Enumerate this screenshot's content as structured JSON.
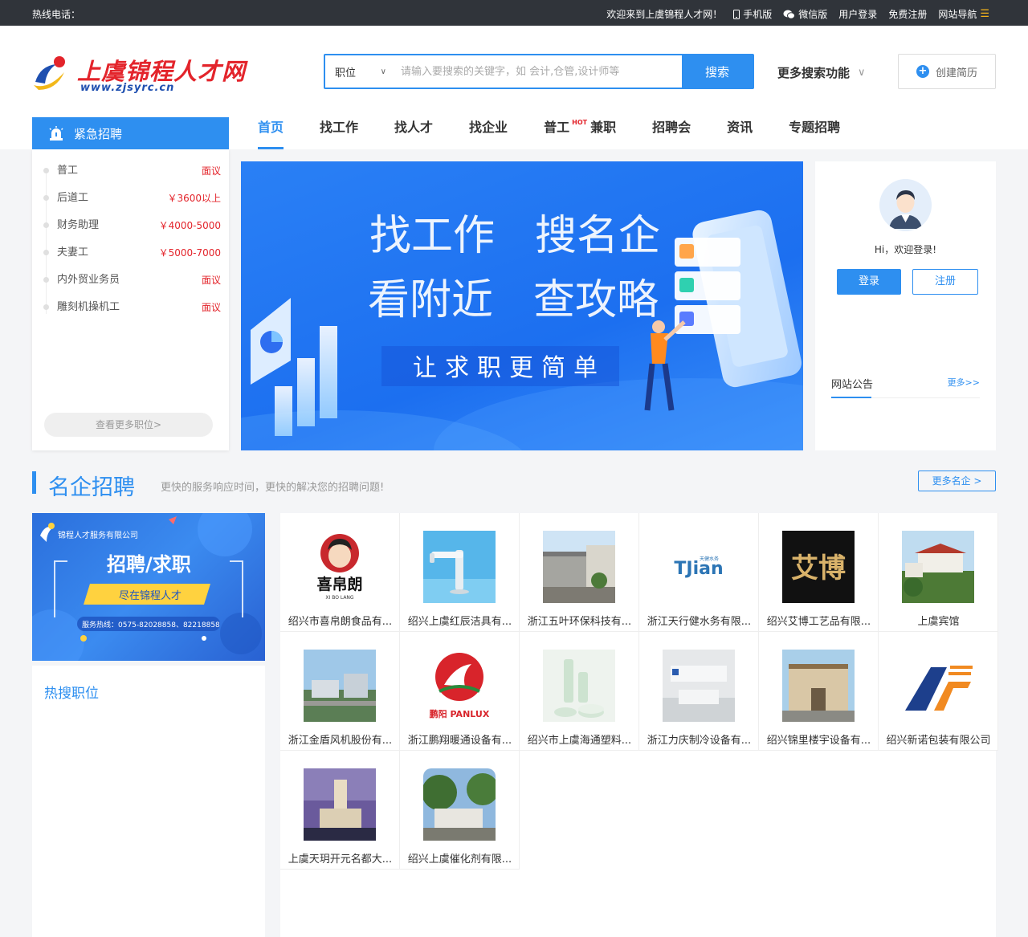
{
  "topbar": {
    "hotline": "热线电话：",
    "welcome": "欢迎来到上虞锦程人才网！",
    "mobile": "手机版",
    "wechat": "微信版",
    "login": "用户登录",
    "register": "免费注册",
    "sitenav": "网站导航"
  },
  "logo": {
    "name": "上虞锦程人才网",
    "domain": "www.zjsyrc.cn"
  },
  "search": {
    "category": "职位",
    "placeholder": "请输入要搜索的关键字，如 会计,仓管,设计师等",
    "button": "搜索"
  },
  "more_search": "更多搜索功能",
  "create_resume": "创建简历",
  "nav": [
    {
      "label": "首页",
      "active": true
    },
    {
      "label": "找工作"
    },
    {
      "label": "找人才"
    },
    {
      "label": "找企业"
    },
    {
      "label": "普工",
      "badge": "HOT"
    },
    {
      "label": "兼职"
    },
    {
      "label": "招聘会"
    },
    {
      "label": "资讯"
    },
    {
      "label": "专题招聘"
    }
  ],
  "urgent": {
    "title": "紧急招聘",
    "jobs": [
      {
        "title": "普工",
        "salary": "面议"
      },
      {
        "title": "后道工",
        "salary": "￥3600以上"
      },
      {
        "title": "财务助理",
        "salary": "￥4000-5000"
      },
      {
        "title": "夫妻工",
        "salary": "￥5000-7000"
      },
      {
        "title": "内外贸业务员",
        "salary": "面议"
      },
      {
        "title": "雕刻机操机工",
        "salary": "面议"
      }
    ],
    "more": "查看更多职位>"
  },
  "banner": {
    "line1a": "找工作",
    "line1b": "搜名企",
    "line2a": "看附近",
    "line2b": "查攻略",
    "slogan": "让求职更简单"
  },
  "loginbox": {
    "greeting": "Hi，欢迎登录!",
    "login": "登录",
    "register": "注册",
    "notice": "网站公告",
    "notice_more": "更多>>"
  },
  "famous": {
    "title": "名企招聘",
    "subtitle": "更快的服务响应时间，更快的解决您的招聘问题!",
    "more": "更多名企 >",
    "companies": [
      {
        "name": "绍兴市喜帛朗食品有...",
        "logo_text": "喜帛朗",
        "logo_sub": "XI BO LANG"
      },
      {
        "name": "绍兴上虞红辰洁具有..."
      },
      {
        "name": "浙江五叶环保科技有..."
      },
      {
        "name": "浙江天行健水务有限...",
        "logo_text": "TJian",
        "logo_sub": "天健水务"
      },
      {
        "name": "绍兴艾博工艺品有限...",
        "logo_text": "艾博"
      },
      {
        "name": "上虞宾馆"
      },
      {
        "name": "浙江金盾风机股份有..."
      },
      {
        "name": "浙江鹏翔暖通设备有...",
        "logo_text": "鹏阳 PANLUX"
      },
      {
        "name": "绍兴市上虞海通塑料..."
      },
      {
        "name": "浙江力庆制冷设备有..."
      },
      {
        "name": "绍兴锦里楼宇设备有..."
      },
      {
        "name": "绍兴新诺包装有限公司"
      },
      {
        "name": "上虞天玥开元名都大..."
      },
      {
        "name": "绍兴上虞催化剂有限..."
      }
    ]
  },
  "promo": {
    "company": "锦程人才服务有限公司",
    "headline": "招聘/求职",
    "tag": "尽在锦程人才",
    "hotline": "服务热线：0575-82028858、82218858"
  },
  "hot_jobs": {
    "title": "热搜职位"
  },
  "colors": {
    "accent": "#2e8ff0",
    "topbar": "#30343a",
    "brand_red": "#e3242b"
  }
}
